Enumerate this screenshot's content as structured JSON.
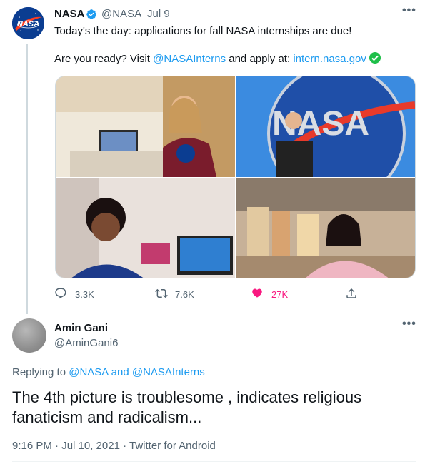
{
  "original_tweet": {
    "author_name": "NASA",
    "author_handle": "@NASA",
    "separator": "·",
    "date": "Jul 9",
    "line1": "Today's the day: applications for fall NASA internships are due!",
    "line2_prefix": "Are you ready? Visit ",
    "mention": "@NASAInterns",
    "line2_middle": " and apply at: ",
    "url": "intern.nasa.gov",
    "media_text": "NASA",
    "actions": {
      "replies": "3.3K",
      "retweets": "7.6K",
      "likes": "27K"
    }
  },
  "reply_tweet": {
    "author_name": "Amin Gani",
    "author_handle": "@AminGani6",
    "replying_prefix": "Replying to ",
    "replying_to_1": "@NASA",
    "replying_and": " and ",
    "replying_to_2": "@NASAInterns",
    "text": "The 4th picture is troublesome , indicates religious fanaticism and radicalism...",
    "timestamp": "9:16 PM · Jul 10, 2021 · Twitter for Android"
  },
  "colors": {
    "accent": "#1d9bf0",
    "like": "#f91880",
    "muted": "#536471",
    "nasa_blue": "#0b3d91",
    "nasa_red": "#fc3d21"
  },
  "icons": [
    "nasa-logo",
    "verified-badge-icon",
    "more-icon",
    "check-emoji-icon",
    "reply-icon",
    "retweet-icon",
    "like-heart-icon",
    "share-icon"
  ]
}
